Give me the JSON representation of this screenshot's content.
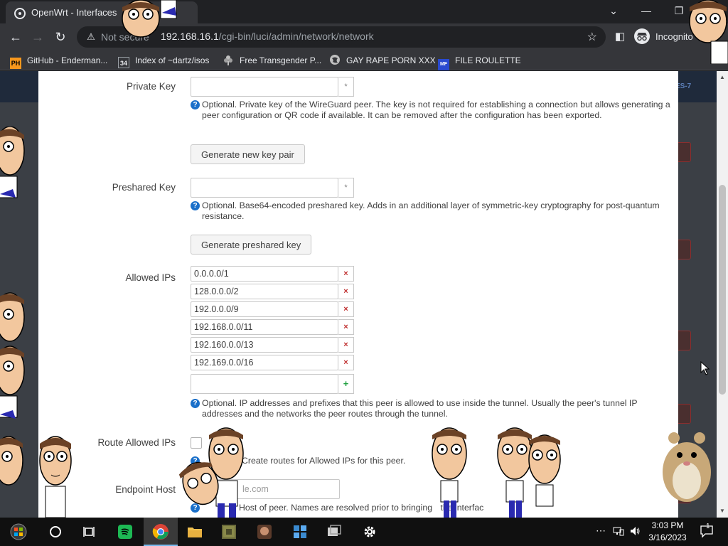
{
  "browser": {
    "tab_title": "OpenWrt - Interfaces",
    "url_warning": "Not secure",
    "url_host": "192.168.16.1",
    "url_path": "/cgi-bin/luci/admin/network/network",
    "incognito_label": "Incognito",
    "window_controls": [
      "chevron-down-icon",
      "minimize-icon",
      "maximize-icon"
    ],
    "bookmarks": [
      {
        "label": "GitHub - Enderman...",
        "icon": "PH",
        "icon_bg": "#f7971d"
      },
      {
        "label": "Index of ~dartz/isos",
        "icon": "34",
        "icon_bg": "#35363a"
      },
      {
        "label": "Free Transgender P...",
        "icon": "flower-icon",
        "icon_bg": "#35363a"
      },
      {
        "label": "GAY RAPE PORN XXX",
        "icon": "globe-icon",
        "icon_bg": "#35363a"
      },
      {
        "label": "FILE ROULETTE",
        "icon": "MF",
        "icon_bg": "#2a4ad0"
      }
    ]
  },
  "page": {
    "header_badge": "ES-7"
  },
  "form": {
    "private_key": {
      "label": "Private Key",
      "value": "",
      "help": "Optional. Private key of the WireGuard peer. The key is not required for establishing a connection but allows generating a peer configuration or QR code if available. It can be removed after the configuration has been exported.",
      "button": "Generate new key pair"
    },
    "preshared_key": {
      "label": "Preshared Key",
      "value": "",
      "help": "Optional. Base64-encoded preshared key. Adds in an additional layer of symmetric-key cryptography for post-quantum resistance.",
      "button": "Generate preshared key"
    },
    "allowed_ips": {
      "label": "Allowed IPs",
      "values": [
        "0.0.0.0/1",
        "128.0.0.0/2",
        "192.0.0.0/9",
        "192.168.0.0/11",
        "192.160.0.0/13",
        "192.169.0.0/16"
      ],
      "new_value": "",
      "help": "Optional. IP addresses and prefixes that this peer is allowed to use inside the tunnel. Usually the peer's tunnel IP addresses and the networks the peer routes through the tunnel."
    },
    "route_allowed_ips": {
      "label": "Route Allowed IPs",
      "checked": false,
      "help": "Create routes for Allowed IPs for this peer."
    },
    "endpoint_host": {
      "label": "Endpoint Host",
      "placeholder": "le.com",
      "help_visible": "Host of peer. Names are resolved prior to bringing",
      "help_visible_2": "the interfac"
    }
  },
  "taskbar": {
    "time": "3:03 PM",
    "date": "3/16/2023",
    "notification_count": "1",
    "apps": [
      "start-icon",
      "cortana-icon",
      "task-view-icon",
      "spotify-icon",
      "chrome-icon",
      "file-explorer-icon",
      "minecraft-icon",
      "photo-app-icon",
      "app-icon",
      "vm-app-icon",
      "settings-icon"
    ]
  },
  "colors": {
    "chrome_dark": "#202124",
    "chrome_toolbar": "#35363a",
    "help_icon": "#1a6fc9",
    "delete": "#c03030",
    "add": "#20a040",
    "taskbar": "#101010"
  }
}
